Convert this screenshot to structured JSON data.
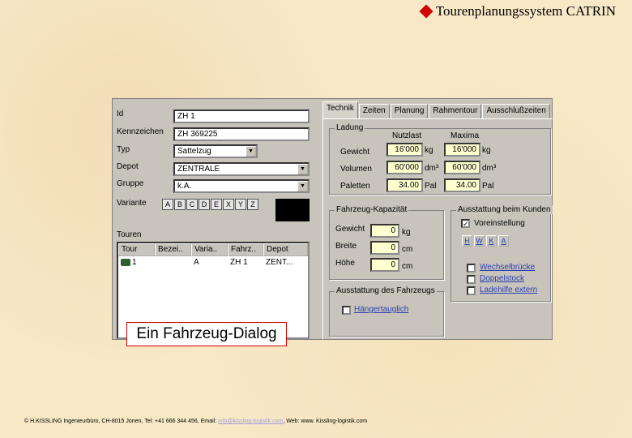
{
  "slide_title": "Tourenplanungssystem CATRIN",
  "left": {
    "id_label": "Id",
    "id_value": "ZH 1",
    "kennzeichen_label": "Kennzeichen",
    "kennzeichen_value": "ZH 369225",
    "typ_label": "Typ",
    "typ_value": "Sattelzug",
    "depot_label": "Depot",
    "depot_value": "ZENTRALE",
    "gruppe_label": "Gruppe",
    "gruppe_value": "k.A.",
    "variante_label": "Variante",
    "variants": [
      "A",
      "B",
      "C",
      "D",
      "E",
      "X",
      "Y",
      "Z"
    ],
    "touren_label": "Touren",
    "grid_headers": [
      "Tour",
      "Bezei..",
      "Varia..",
      "Fahrz..",
      "Depot"
    ],
    "grid_rows": [
      [
        "1",
        "",
        "A",
        "ZH 1",
        "ZENT..."
      ]
    ]
  },
  "tabs": [
    "Technik",
    "Zeiten",
    "Planung",
    "Rahmentour",
    "Ausschlußzeiten"
  ],
  "ladung": {
    "title": "Ladung",
    "col_nutzlast": "Nutzlast",
    "col_maxima": "Maxima",
    "rows": [
      {
        "label": "Gewicht",
        "nutzlast": "16'000",
        "unit1": "kg",
        "maxima": "16'000",
        "unit2": "kg"
      },
      {
        "label": "Volumen",
        "nutzlast": "60'000",
        "unit1": "dm³",
        "maxima": "60'000",
        "unit2": "dm³"
      },
      {
        "label": "Paletten",
        "nutzlast": "34.00",
        "unit1": "Pal",
        "maxima": "34.00",
        "unit2": "Pal"
      }
    ]
  },
  "kapazitaet": {
    "title": "Fahrzeug-Kapazität",
    "rows": [
      {
        "label": "Gewicht",
        "value": "0",
        "unit": "kg"
      },
      {
        "label": "Breite",
        "value": "0",
        "unit": "cm"
      },
      {
        "label": "Höhe",
        "value": "0",
        "unit": "cm"
      }
    ]
  },
  "ausstattung_fahrzeug": {
    "title": "Ausstattung des Fahrzeugs",
    "anhaenger_label": "Hängertauglich"
  },
  "ausstattung_kunden": {
    "title": "Ausstattung beim Kunden",
    "voreinstellung_label": "Voreinstellung",
    "buttons": [
      "H",
      "W",
      "K",
      "A"
    ],
    "options": [
      "Wechselbrücke",
      "Doppelstock",
      "Ladehilfe extern"
    ]
  },
  "caption": "Ein Fahrzeug-Dialog",
  "footer": {
    "text1": "© H.KISSLING Ingenieurbüro, CH-8015 Jonen, Tel: +41 666 344 456, Email: ",
    "email": "info@kissling-logistik.com",
    "text2": ", Web: www. Kissling-logistik.com"
  }
}
